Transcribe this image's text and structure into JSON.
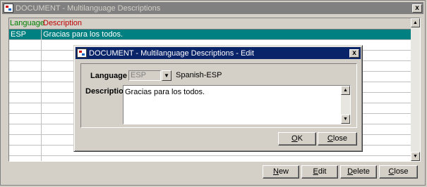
{
  "main_window": {
    "title": "DOCUMENT - Multilanguage Descriptions",
    "close_label": "x"
  },
  "grid": {
    "headers": {
      "language": "Language",
      "description": "Description"
    },
    "rows": [
      {
        "language": "ESP",
        "description": "Gracias para los todos."
      },
      {
        "language": "",
        "description": ""
      },
      {
        "language": "",
        "description": ""
      },
      {
        "language": "",
        "description": ""
      },
      {
        "language": "",
        "description": ""
      },
      {
        "language": "",
        "description": ""
      },
      {
        "language": "",
        "description": ""
      },
      {
        "language": "",
        "description": ""
      },
      {
        "language": "",
        "description": ""
      },
      {
        "language": "",
        "description": ""
      },
      {
        "language": "",
        "description": ""
      },
      {
        "language": "",
        "description": ""
      },
      {
        "language": "",
        "description": ""
      }
    ]
  },
  "main_buttons": {
    "new": {
      "mnemonic": "N",
      "rest": "ew"
    },
    "edit": {
      "mnemonic": "E",
      "rest": "dit"
    },
    "delete": {
      "mnemonic": "D",
      "rest": "elete"
    },
    "close": {
      "mnemonic": "C",
      "rest": "lose"
    }
  },
  "edit_dialog": {
    "title": "DOCUMENT - Multilanguage Descriptions - Edit",
    "close_label": "x",
    "language_label": "Language",
    "language_code": "ESP",
    "language_name": "Spanish-ESP",
    "description_label": "Description",
    "description_value": "Gracias para los todos.",
    "ok": {
      "mnemonic": "O",
      "rest": "K"
    },
    "close": {
      "mnemonic": "C",
      "rest": "lose"
    }
  },
  "icons": {
    "app_icon": "document-app-icon",
    "combo_arrow": "dropdown-arrow-icon",
    "scroll_up": "scroll-up-arrow-icon",
    "scroll_down": "scroll-down-arrow-icon"
  },
  "colors": {
    "selected_row": "#008080",
    "active_titlebar": "#0a246a",
    "inactive_titlebar": "#808080",
    "header_language": "#008000",
    "header_description": "#c00000"
  }
}
